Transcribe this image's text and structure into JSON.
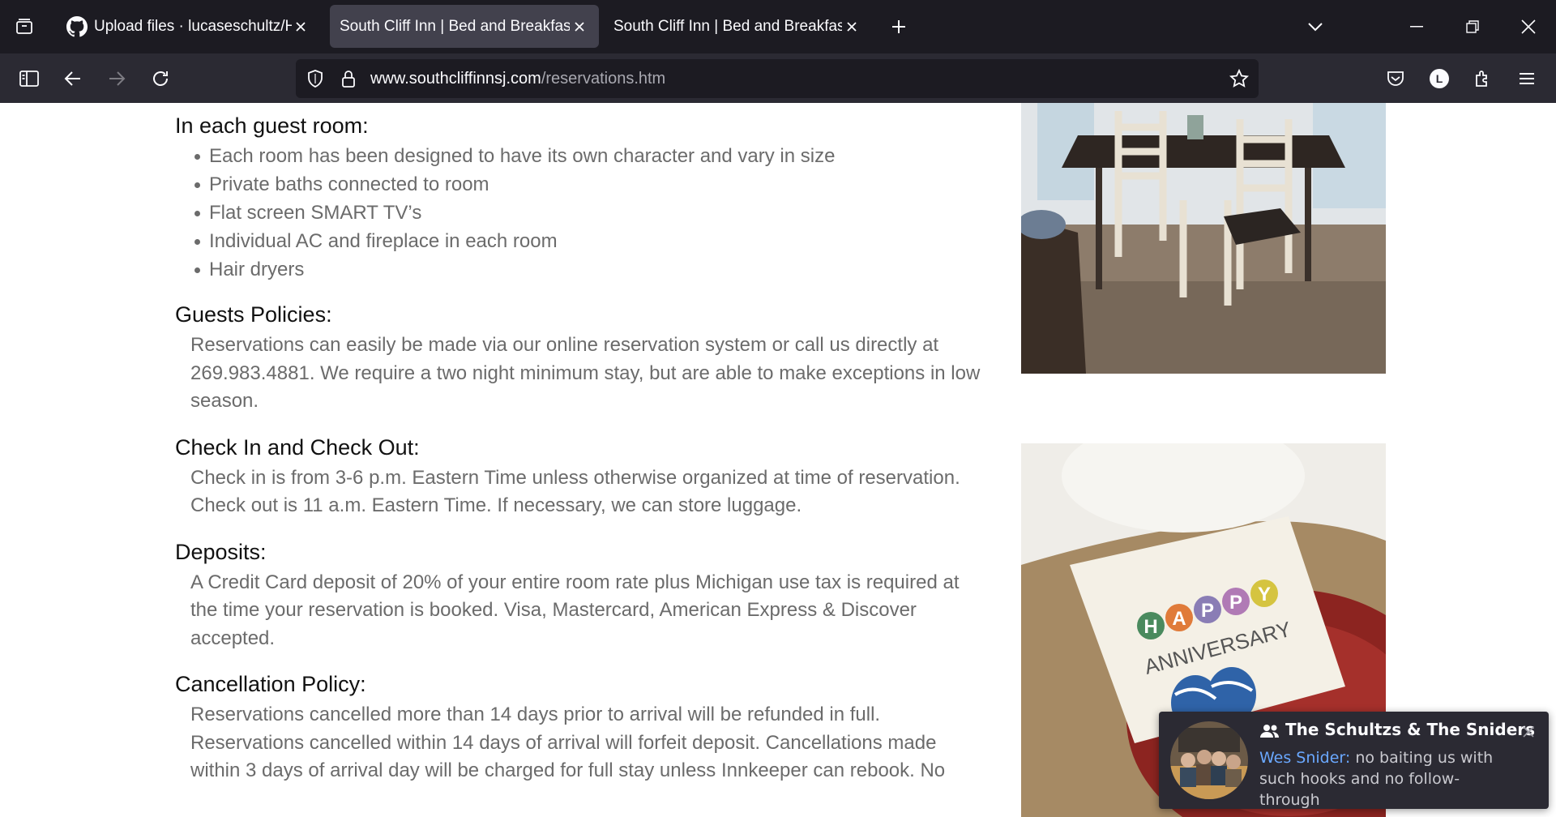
{
  "browser": {
    "tabs": [
      {
        "title": "Upload files · lucaseschultz/HTT",
        "active": false
      },
      {
        "title": "South Cliff Inn | Bed and Breakfast |",
        "active": true
      },
      {
        "title": "South Cliff Inn | Bed and Breakfast |",
        "active": false
      }
    ],
    "url": {
      "domain": "www.southcliffinnsj.com",
      "path": "/reservations.htm"
    }
  },
  "page": {
    "guest_room": {
      "heading": "In each guest room:",
      "items": [
        "Each room has been designed to have its own character and vary in size",
        "Private baths connected to room",
        "Flat screen SMART TV’s",
        "Individual AC and fireplace in each room",
        "Hair dryers"
      ]
    },
    "policies": {
      "heading": "Guests Policies:",
      "text": "Reservations can easily be made via our online reservation system or call us directly at 269.983.4881. We require a two night minimum stay, but are able to make exceptions in low season."
    },
    "checkin": {
      "heading": "Check In and Check Out:",
      "text": "Check in is from 3-6 p.m. Eastern Time unless otherwise organized at time of reservation. Check out is 11 a.m. Eastern Time. If necessary, we can store luggage."
    },
    "deposits": {
      "heading": "Deposits:",
      "text": "A Credit Card deposit of 20% of your entire room rate plus Michigan use tax is required at the time your reservation is booked. Visa, Mastercard, American Express & Discover accepted."
    },
    "cancellation": {
      "heading": "Cancellation Policy:",
      "text": "Reservations cancelled more than 14 days prior to arrival will be refunded in full. Reservations cancelled within 14 days of arrival will forfeit deposit.  Cancellations made within 3 days of arrival day will be charged for full stay unless Innkeeper can rebook. No"
    },
    "photo2_card": {
      "word1": "HAPPY",
      "word2": "ANNIVERSARY"
    }
  },
  "notification": {
    "title": "The Schultzs & The Sniders",
    "sender": "Wes Snider:",
    "message": " no baiting us with such hooks and no follow-through"
  }
}
